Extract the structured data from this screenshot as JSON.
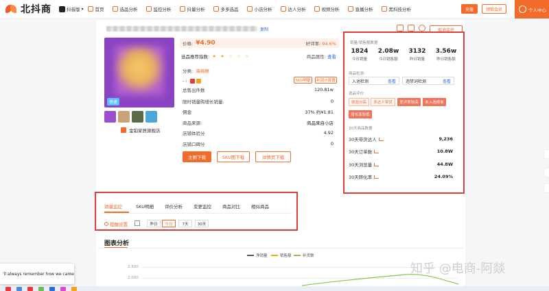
{
  "header": {
    "logo_text": "北抖商",
    "platform": "抖音版",
    "nav": [
      {
        "label": "首页"
      },
      {
        "label": "选品分析"
      },
      {
        "label": "监控分析"
      },
      {
        "label": "抖量分析"
      },
      {
        "label": "多多选品"
      },
      {
        "label": "小店分析"
      },
      {
        "label": "达人分析"
      },
      {
        "label": "视频分析"
      },
      {
        "label": "直播分析"
      },
      {
        "label": "黑科技分析"
      }
    ],
    "member_btn": "充值",
    "claim_btn": "领取会员",
    "user_center": "个人中心"
  },
  "product": {
    "copy_link": "复制",
    "cancel_monitor": "取消监控",
    "img_tag": "快递",
    "shop_name": "金铂家居旗舰店",
    "price_label": "价格:",
    "price": "¥4.90",
    "good_rate_label": "好评率:",
    "good_rate": "94.6%",
    "rec_label": "选品推荐指数:",
    "rec_stars": "★ ★ ☆ ☆ ☆",
    "attr_label": "商品属性:",
    "attr_link": "查看",
    "category_label": "分类:",
    "category": "海绵擦",
    "sku_btn": "SKU明细",
    "calc_btn": "利润计算器",
    "rows": [
      {
        "label": "总售出件数",
        "value": "120.81w"
      },
      {
        "label": "限时销量购增长销量:",
        "value": "0"
      },
      {
        "label": "佣金",
        "value": "37% 约¥1.81"
      },
      {
        "label": "商品来源:",
        "value": "商品来自小店"
      },
      {
        "label": "店铺体验分",
        "value": "4.92"
      },
      {
        "label": "店铺口碑分",
        "value": "0"
      }
    ],
    "actions": {
      "main_download": "主图下载",
      "sku_download": "SKU图下载",
      "detail_download": "详情页下载"
    }
  },
  "sales_panel": {
    "title": "销量/销售额数据",
    "stats": [
      {
        "value": "1824",
        "label": "今日销量"
      },
      {
        "value": "2.08w",
        "label": "今日销售额"
      },
      {
        "value": "3132",
        "label": "昨日销量"
      },
      {
        "value": "3.56w",
        "label": "昨日销售额"
      }
    ],
    "check_title": "商品检测:",
    "check_left": "入池检测",
    "check_left_link": "查看",
    "check_right": "违禁词检测",
    "check_right_link": "查看",
    "eval_title": "选品评价:",
    "eval_tags": [
      {
        "label": "体验分高",
        "style": "outline"
      },
      {
        "label": "多达人带货",
        "style": "outline"
      },
      {
        "label": "差评率较高",
        "style": "solid"
      },
      {
        "label": "未入选榜单",
        "style": "solid"
      },
      {
        "label": "增长率较低",
        "style": "solid"
      }
    ],
    "m30_title": "30天商品数据",
    "m30_rows": [
      {
        "label": "30天带货达人",
        "value": "9,236"
      },
      {
        "label": "30天订单数",
        "value": "10.8W"
      },
      {
        "label": "30天浏览量",
        "value": "44.8W"
      },
      {
        "label": "30天转化率",
        "value": "24.09%"
      }
    ]
  },
  "tabs": {
    "items": [
      {
        "label": "销量监控"
      },
      {
        "label": "SKU明细"
      },
      {
        "label": "评价分析"
      },
      {
        "label": "变更监控"
      },
      {
        "label": "商品对比"
      },
      {
        "label": "相似商品"
      }
    ],
    "settings": "提醒设置",
    "ranges": [
      "昨日",
      "今日",
      "7天",
      "30天"
    ],
    "active_range": "今日"
  },
  "chart": {
    "title": "图表分析",
    "legend": [
      {
        "name": "净销量",
        "color": "#555555"
      },
      {
        "name": "销售额",
        "color": "#f3a31d"
      },
      {
        "name": "补货数",
        "color": "#8bc34a"
      }
    ],
    "y_ticks": [
      "2,500",
      "2,000"
    ]
  },
  "toast": {
    "text": "'ll always remember how we came"
  },
  "watermark": "知乎 @电商-阿燚"
}
